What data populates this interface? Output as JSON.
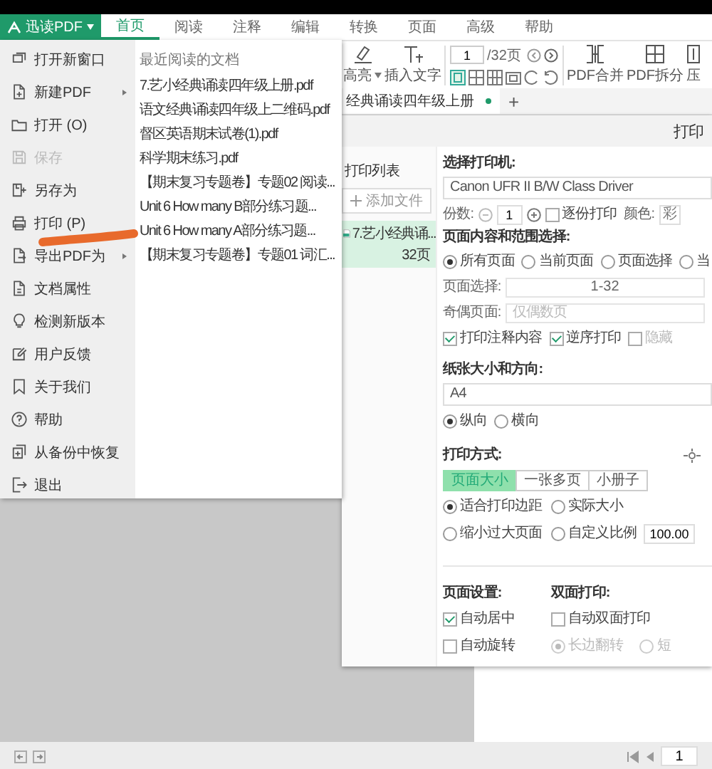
{
  "app_menu_button": {
    "label": "迅读PDF"
  },
  "ribbon_tabs": [
    {
      "label": "首页",
      "selected": true
    },
    {
      "label": "阅读",
      "selected": false
    },
    {
      "label": "注释",
      "selected": false
    },
    {
      "label": "编辑",
      "selected": false
    },
    {
      "label": "转换",
      "selected": false
    },
    {
      "label": "页面",
      "selected": false
    },
    {
      "label": "高级",
      "selected": false
    },
    {
      "label": "帮助",
      "selected": false
    }
  ],
  "toolbar": {
    "highlight": "高亮",
    "insert_text": "插入文字",
    "page_field": "1",
    "page_count": "/32页",
    "merge": "PDF合并",
    "split": "PDF拆分",
    "compress": "压"
  },
  "doc_tabs": [
    {
      "label": "经典诵读四年级上册",
      "selected": true
    }
  ],
  "new_tab": "+",
  "file_menu": {
    "items": [
      {
        "label": "打开新窗口",
        "disabled": false,
        "submenu": false
      },
      {
        "label": "新建PDF",
        "disabled": false,
        "submenu": true
      },
      {
        "label": "打开 (O)",
        "disabled": false,
        "submenu": false
      },
      {
        "label": "保存",
        "disabled": true,
        "submenu": false
      },
      {
        "label": "另存为",
        "disabled": false,
        "submenu": false
      },
      {
        "label": "打印 (P)",
        "disabled": false,
        "submenu": false
      },
      {
        "label": "导出PDF为",
        "disabled": false,
        "submenu": true
      },
      {
        "label": "文档属性",
        "disabled": false,
        "submenu": false
      },
      {
        "label": "检测新版本",
        "disabled": false,
        "submenu": false
      },
      {
        "label": "用户反馈",
        "disabled": false,
        "submenu": false
      },
      {
        "label": "关于我们",
        "disabled": false,
        "submenu": false
      },
      {
        "label": "帮助",
        "disabled": false,
        "submenu": false
      },
      {
        "label": "从备份中恢复",
        "disabled": false,
        "submenu": false
      },
      {
        "label": "退出",
        "disabled": false,
        "submenu": false
      }
    ],
    "recent": {
      "title": "最近阅读的文档",
      "files": [
        "7.艺小经典诵读四年级上册.pdf",
        "语文经典诵读四年级上二维码.pdf",
        "督区英语期末试卷(1).pdf",
        "科学期末练习.pdf",
        "【期末复习专题卷】专题02 阅读...",
        "Unit 6 How many B部分练习题...",
        "Unit 6 How many A部分练习题...",
        "【期末复习专题卷】专题01 词汇..."
      ]
    }
  },
  "print_dialog": {
    "title": "打印",
    "list_title": "打印列表",
    "add_file": "添加文件",
    "files": [
      {
        "name": "7.艺小经典诵...",
        "pages": "32页",
        "selected": true
      }
    ],
    "printer_label": "选择打印机:",
    "printer": "Canon UFR II B/W Class Driver",
    "copies_label": "份数:",
    "copies": "1",
    "collate": {
      "label": "逐份打印",
      "checked": false
    },
    "color_label": "颜色:",
    "color_mode": "彩",
    "range_label": "页面内容和范围选择:",
    "range_options": [
      {
        "label": "所有页面",
        "selected": true
      },
      {
        "label": "当前页面",
        "selected": false
      },
      {
        "label": "页面选择",
        "selected": false
      },
      {
        "label": "当",
        "selected": false
      }
    ],
    "pages_label": "页面选择:",
    "pages": "1-32",
    "odd_even_label": "奇偶页面:",
    "odd_even": "仅偶数页",
    "options": [
      {
        "label": "打印注释内容",
        "checked": true,
        "disabled": false
      },
      {
        "label": "逆序打印",
        "checked": true,
        "disabled": false
      },
      {
        "label": "隐藏",
        "checked": false,
        "disabled": true
      }
    ],
    "paper_label": "纸张大小和方向:",
    "paper": "A4",
    "orientation": [
      {
        "label": "纵向",
        "selected": true
      },
      {
        "label": "横向",
        "selected": false
      }
    ],
    "mode_label": "打印方式:",
    "modes": [
      {
        "label": "页面大小",
        "selected": true
      },
      {
        "label": "一张多页",
        "selected": false
      },
      {
        "label": "小册子",
        "selected": false
      }
    ],
    "scaling": [
      {
        "label": "适合打印边距",
        "selected": true
      },
      {
        "label": "实际大小",
        "selected": false
      },
      {
        "label": "缩小过大页面",
        "selected": false
      },
      {
        "label": "自定义比例",
        "selected": false
      }
    ],
    "scale": "100.00",
    "page_setup_label": "页面设置:",
    "page_setup": [
      {
        "label": "自动居中",
        "checked": true
      },
      {
        "label": "自动旋转",
        "checked": false
      }
    ],
    "duplex_label": "双面打印:",
    "duplex": {
      "label": "自动双面打印",
      "checked": false
    },
    "flip": [
      {
        "label": "长边翻转",
        "selected": true,
        "disabled": true
      },
      {
        "label": "短",
        "selected": false,
        "disabled": true
      }
    ]
  },
  "status_bar": {
    "page_field": "1"
  }
}
